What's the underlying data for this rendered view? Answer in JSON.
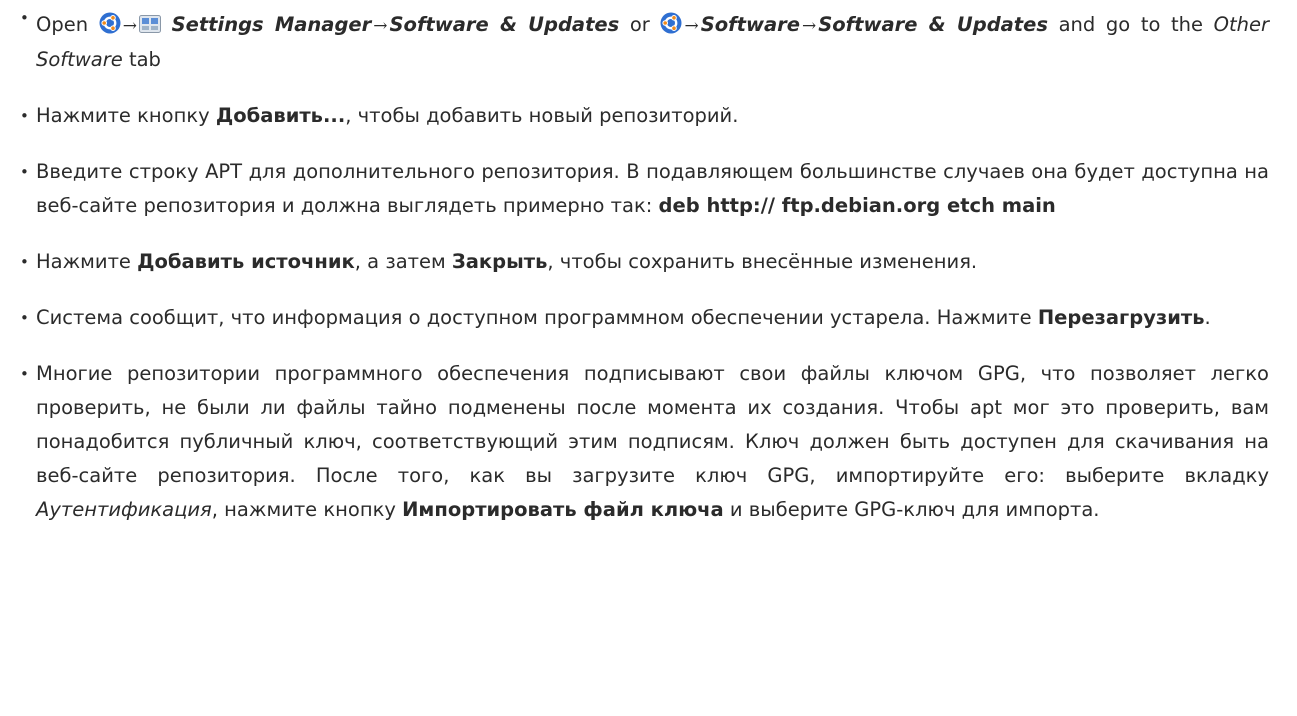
{
  "steps": [
    {
      "open": "Open",
      "settings_manager": "Settings Manager",
      "software_updates": "Software & Updates",
      "or": "or",
      "software": "Software",
      "software_updates_2": "Software & Updates",
      "and_go": "and go to the",
      "other_software": "Other Software",
      "tab": "tab"
    },
    {
      "pre": "Нажмите кнопку ",
      "bold": "Добавить...",
      "post": ", чтобы добавить новый репозиторий."
    },
    {
      "pre": "Введите строку APT для дополнительного репозитория. В подавляющем большинстве случаев она будет доступна на веб-сайте репозитория и должна выглядеть примерно так: ",
      "bold": "deb http:// ftp.debian.org etch main"
    },
    {
      "pre": "Нажмите ",
      "bold1": "Добавить источник",
      "mid": ", а затем ",
      "bold2": "Закрыть",
      "post": ", чтобы сохранить внесённые изменения."
    },
    {
      "pre": "Система сообщит, что информация о доступном программном обеспечении устарела. Нажмите ",
      "bold": "Перезагрузить",
      "post": "."
    },
    {
      "pre": "Многие репозитории программного обеспечения подписывают свои файлы ключом GPG, что позволяет легко проверить, не были ли файлы тайно подменены после момента их создания. Чтобы apt мог это проверить, вам понадобится публичный ключ, соответствующий этим подписям. Ключ должен быть доступен для скачивания на веб-сайте репозитория. После того, как вы загрузите ключ GPG, импортируйте его: выберите вкладку ",
      "italic": "Аутентификация",
      "mid": ", нажмите кнопку ",
      "bold": "Импортировать файл ключа",
      "post": " и выберите GPG-ключ для импорта."
    }
  ],
  "icons": {
    "menu": "ubuntu-logo-icon",
    "settings": "settings-manager-icon",
    "arrow": "→"
  },
  "colors": {
    "text": "#2b2b2b",
    "ubuntu_blue": "#2f6fd1",
    "ubuntu_orange": "#f08a1c"
  }
}
